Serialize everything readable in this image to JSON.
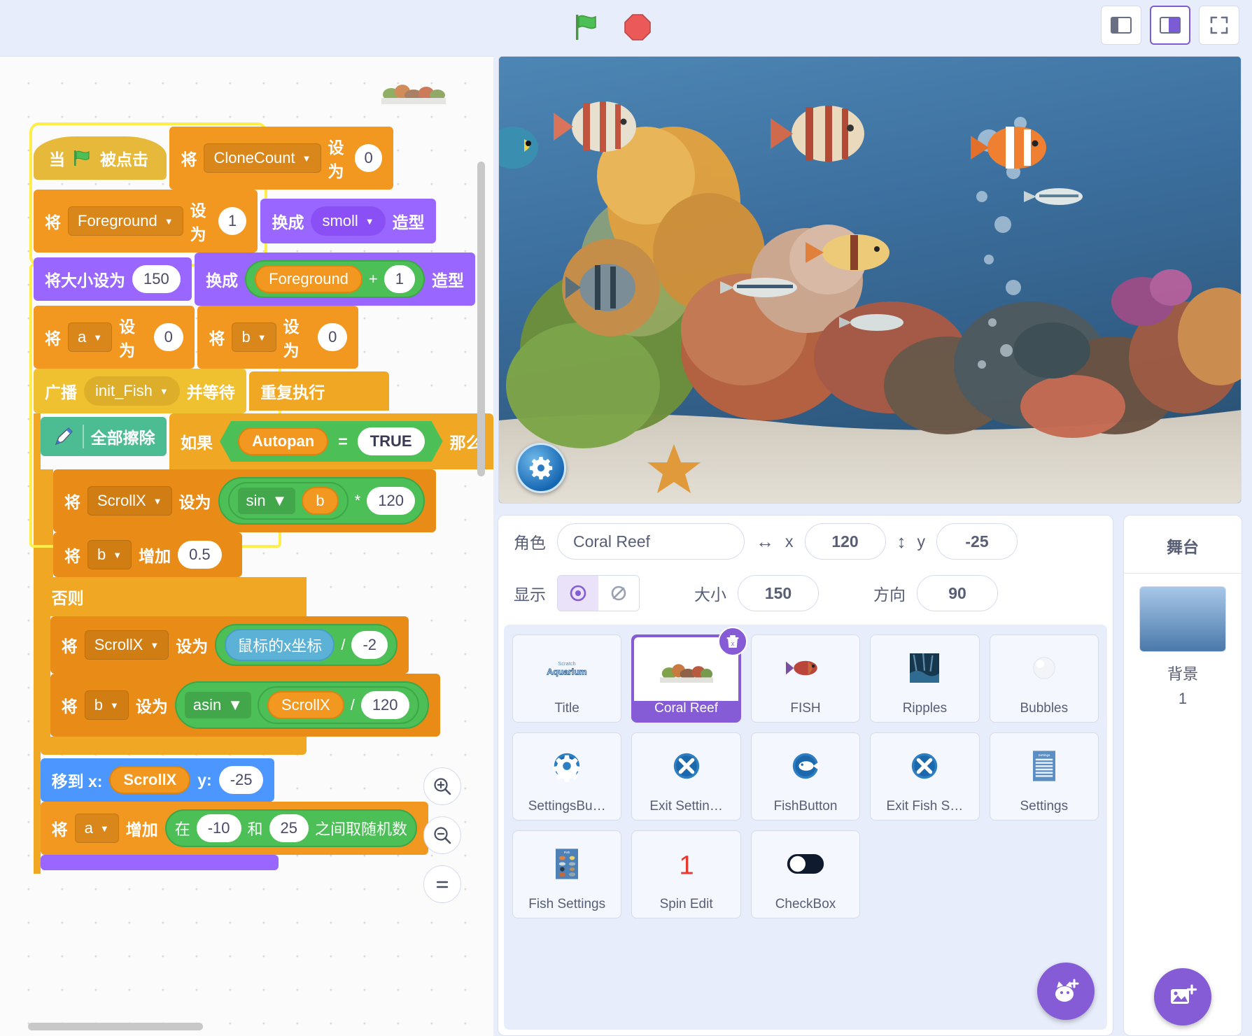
{
  "toolbar": {
    "green_flag": "green-flag",
    "stop": "stop-sign",
    "small_stage": "small-stage-layout",
    "large_stage": "large-stage-layout",
    "fullscreen": "fullscreen"
  },
  "code": {
    "blocks": {
      "hat_when": "当",
      "hat_clicked": "被点击",
      "set": "将",
      "set_to": "设为",
      "change_by": "增加",
      "switch_costume_pre": "换成",
      "switch_costume_post": "造型",
      "set_size_to": "将大小设为",
      "broadcast": "广播",
      "and_wait": "并等待",
      "forever": "重复执行",
      "erase_all": "全部擦除",
      "if": "如果",
      "then": "那么",
      "else": "否则",
      "goto_x": "移到 x:",
      "goto_y": "y:",
      "pick_random_pre": "在",
      "pick_random_mid": "和",
      "pick_random_post": "之间取随机数",
      "mouse_x": "鼠标的x坐标"
    },
    "values": {
      "clonecount_var": "CloneCount",
      "clonecount_val": "0",
      "foreground_var": "Foreground",
      "foreground_val": "1",
      "costume_smoll": "smoll",
      "size_150": "150",
      "foreground_pill": "Foreground",
      "plus": "+",
      "plus_one": "1",
      "a_var": "a",
      "a_val": "0",
      "b_var": "b",
      "b_val": "0",
      "broadcast_msg": "init_Fish",
      "autopan_var": "Autopan",
      "equals": "=",
      "true_val": "TRUE",
      "scrollx_var": "ScrollX",
      "sin_op": "sin",
      "sin_arg": "b",
      "times": "*",
      "times_val": "120",
      "b_change_var": "b",
      "b_change_val": "0.5",
      "scrollx_var2": "ScrollX",
      "divide": "/",
      "mouse_div": "-2",
      "b_set_var": "b",
      "asin_op": "asin",
      "asin_arg": "ScrollX",
      "asin_div": "120",
      "goto_x_val": "ScrollX",
      "goto_y_val": "-25",
      "a_change_var": "a",
      "rand_min": "-10",
      "rand_max": "25"
    },
    "zoom": {
      "in": "zoom-in",
      "out": "zoom-out",
      "reset": "zoom-reset"
    }
  },
  "sprite_info": {
    "name_label": "角色",
    "name_value": "Coral Reef",
    "x_label": "x",
    "x_value": "120",
    "y_label": "y",
    "y_value": "-25",
    "show_label": "显示",
    "size_label": "大小",
    "size_value": "150",
    "direction_label": "方向",
    "direction_value": "90"
  },
  "sprites": [
    {
      "name": "Title",
      "kind": "title",
      "selected": false
    },
    {
      "name": "Coral Reef",
      "kind": "reef",
      "selected": true
    },
    {
      "name": "FISH",
      "kind": "fish",
      "selected": false
    },
    {
      "name": "Ripples",
      "kind": "ripples",
      "selected": false
    },
    {
      "name": "Bubbles",
      "kind": "bubbles",
      "selected": false
    },
    {
      "name": "SettingsBu…",
      "kind": "gear",
      "selected": false
    },
    {
      "name": "Exit Settin…",
      "kind": "xmark",
      "selected": false
    },
    {
      "name": "FishButton",
      "kind": "fishbtn",
      "selected": false
    },
    {
      "name": "Exit Fish S…",
      "kind": "xmark",
      "selected": false
    },
    {
      "name": "Settings",
      "kind": "settings-panel",
      "selected": false
    },
    {
      "name": "Fish Settings",
      "kind": "fish-settings",
      "selected": false
    },
    {
      "name": "Spin Edit",
      "kind": "number-one",
      "selected": false
    },
    {
      "name": "CheckBox",
      "kind": "toggle",
      "selected": false
    }
  ],
  "stage_panel": {
    "title": "舞台",
    "backdrop_label": "背景",
    "backdrop_count": "1"
  },
  "colors": {
    "accent": "#855cd6",
    "data": "#f2971f",
    "looks": "#9966ff",
    "events": "#efc030",
    "control": "#efa724",
    "motion": "#4c97ff",
    "pen": "#4cbd93",
    "operators": "#4cbf56",
    "sensing": "#5cb1d6"
  }
}
